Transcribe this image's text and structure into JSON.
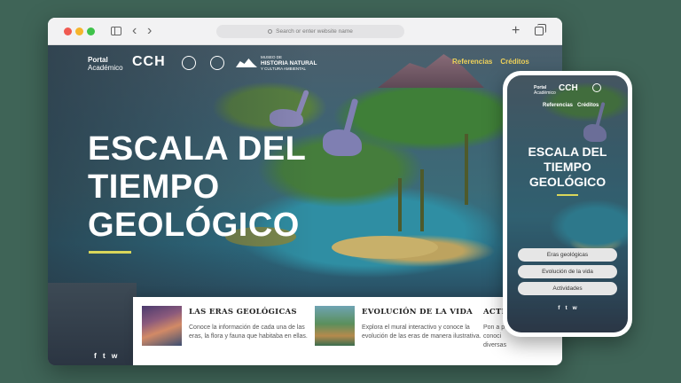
{
  "browser": {
    "url_placeholder": "Search or enter website name"
  },
  "site": {
    "logo_portal_top": "Portal",
    "logo_portal_bottom": "Académico",
    "logo_cch": "CCH",
    "logo_museo_small": "MUSEO DE",
    "logo_museo_main": "HISTORIA NATURAL",
    "logo_museo_sub": "Y CULTURA AMBIENTAL",
    "nav_links": [
      "Referencias",
      "Créditos"
    ],
    "hero_title_lines": [
      "ESCALA DEL",
      "TIEMPO",
      "GEOLÓGICO"
    ],
    "accent_color": "#d9d65a",
    "social": [
      "f",
      "t",
      "w"
    ]
  },
  "cards": [
    {
      "title": "LAS ERAS GEOLÓGICAS",
      "text": "Conoce la información de cada una de las eras, la flora y fauna que habitaba en ellas."
    },
    {
      "title": "EVOLUCIÓN DE LA VIDA",
      "text": "Explora el mural interactivo y conoce la evolución de las eras de manera ilustrativa."
    },
    {
      "title": "ACTIV",
      "text_lines": [
        "Pon a p",
        "conoci",
        "diversas"
      ]
    }
  ],
  "phone": {
    "nav_links": [
      "Referencias",
      "Créditos"
    ],
    "title_lines": [
      "ESCALA DEL",
      "TIEMPO",
      "GEOLÓGICO"
    ],
    "buttons": [
      "Eras geológicas",
      "Evolución de la vida",
      "Actividades"
    ]
  }
}
